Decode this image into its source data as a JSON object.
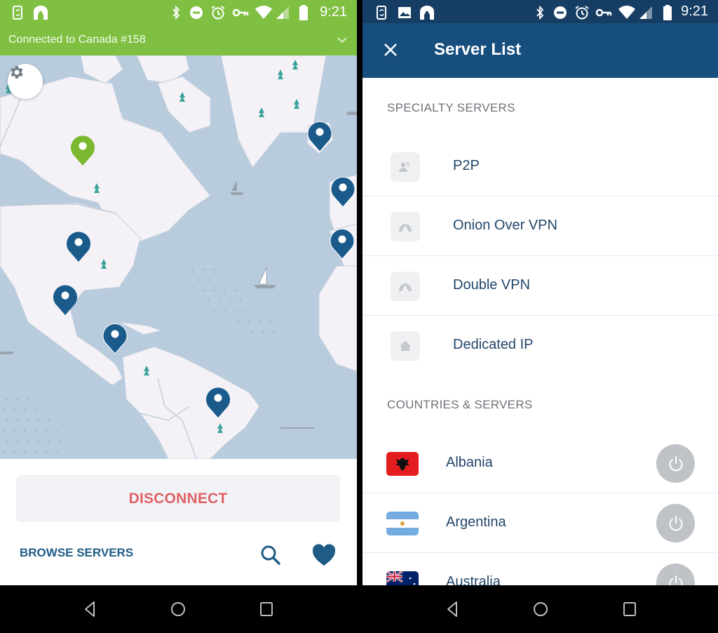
{
  "left_screen": {
    "status_bar": {
      "time": "9:21",
      "left_icons": [
        "phone-sync-icon",
        "vpn-keyhole-icon"
      ],
      "right_icons": [
        "bluetooth-icon",
        "do-not-disturb-icon",
        "alarm-icon",
        "vpn-key-icon",
        "wifi-icon",
        "cell-signal-icon",
        "battery-icon"
      ]
    },
    "connection_banner": {
      "text": "Connected to Canada #158",
      "icon": "chevron-down-icon"
    },
    "map": {
      "settings_icon": "gear-icon",
      "active_pin_color": "#7cb82f",
      "pin_color": "#1a5b8c",
      "pins": [
        "canada",
        "greenland",
        "europe-west-1",
        "europe-west-2",
        "united-states",
        "mexico",
        "central-america",
        "brazil"
      ]
    },
    "actions": {
      "disconnect_label": "DISCONNECT",
      "browse_label": "BROWSE SERVERS",
      "search_icon": "search-icon",
      "favorites_icon": "heart-icon"
    },
    "colors": {
      "accent_green": "#7fc043",
      "disconnect_red": "#e06165",
      "brand_blue": "#1f5c85"
    }
  },
  "right_screen": {
    "status_bar": {
      "time": "9:21",
      "left_icons": [
        "phone-sync-icon",
        "image-icon",
        "vpn-keyhole-icon"
      ],
      "right_icons": [
        "bluetooth-icon",
        "do-not-disturb-icon",
        "alarm-icon",
        "vpn-key-icon",
        "wifi-icon",
        "cell-signal-icon",
        "battery-icon"
      ]
    },
    "app_bar": {
      "title": "Server List",
      "close_icon": "close-icon"
    },
    "specialty_header": "SPECIALTY SERVERS",
    "specialty_servers": [
      {
        "label": "P2P",
        "icon": "p2p-users-icon"
      },
      {
        "label": "Onion Over VPN",
        "icon": "onion-icon"
      },
      {
        "label": "Double VPN",
        "icon": "double-vpn-icon"
      },
      {
        "label": "Dedicated IP",
        "icon": "home-icon"
      }
    ],
    "countries_header": "COUNTRIES & SERVERS",
    "countries": [
      {
        "label": "Albania",
        "flag": "albania-flag-icon"
      },
      {
        "label": "Argentina",
        "flag": "argentina-flag-icon"
      },
      {
        "label": "Australia",
        "flag": "australia-flag-icon"
      }
    ],
    "colors": {
      "header_blue": "#164f7e",
      "statusbar_blue": "#163e64",
      "text_blue": "#22466a"
    }
  },
  "nav_bar": {
    "buttons": [
      "back-icon",
      "home-icon",
      "recents-icon"
    ]
  }
}
